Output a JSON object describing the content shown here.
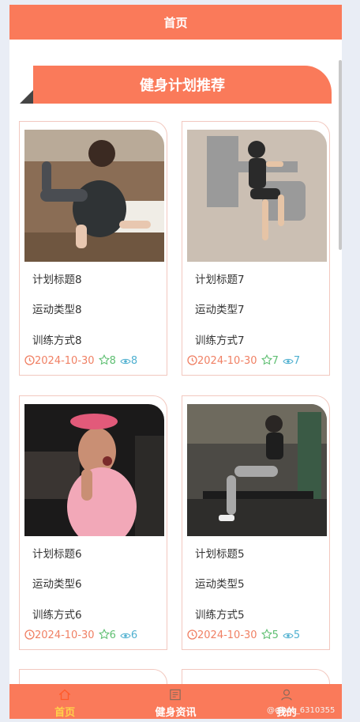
{
  "header": {
    "title": "首页"
  },
  "section": {
    "title": "健身计划推荐"
  },
  "cards": [
    {
      "title": "计划标题8",
      "type": "运动类型8",
      "method": "训练方式8",
      "date": "2024-10-30",
      "likes": "8",
      "views": "8",
      "image": "woman-stretching-on-floor"
    },
    {
      "title": "计划标题7",
      "type": "运动类型7",
      "method": "训练方式7",
      "date": "2024-10-30",
      "likes": "7",
      "views": "7",
      "image": "woman-on-exercise-machine"
    },
    {
      "title": "计划标题6",
      "type": "运动类型6",
      "method": "训练方式6",
      "date": "2024-10-30",
      "likes": "6",
      "views": "6",
      "image": "tennis-player-celebrating"
    },
    {
      "title": "计划标题5",
      "type": "运动类型5",
      "method": "训练方式5",
      "date": "2024-10-30",
      "likes": "5",
      "views": "5",
      "image": "woman-on-rowing-machine"
    }
  ],
  "nav": [
    {
      "label": "首页",
      "icon": "home-icon",
      "active": true
    },
    {
      "label": "健身资讯",
      "icon": "news-icon",
      "active": false
    },
    {
      "label": "我的",
      "icon": "user-icon",
      "active": false
    }
  ],
  "watermark": "@qqwx_6310355",
  "colors": {
    "accent": "#fa7a5a",
    "active_nav": "#ffd24a",
    "date": "#f08064",
    "like": "#5fbf72",
    "view": "#4fb0d0"
  }
}
